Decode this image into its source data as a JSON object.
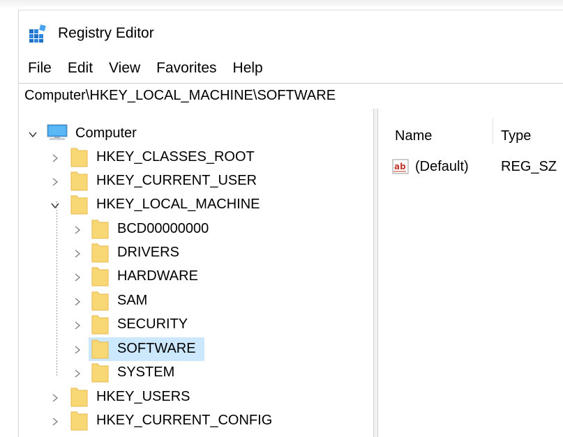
{
  "window": {
    "title": "Registry Editor",
    "app_icon": "registry-editor-icon"
  },
  "menu": [
    "File",
    "Edit",
    "View",
    "Favorites",
    "Help"
  ],
  "address": "Computer\\HKEY_LOCAL_MACHINE\\SOFTWARE",
  "tree": {
    "root": {
      "label": "Computer",
      "icon": "computer-icon",
      "expanded": true
    },
    "hives": [
      {
        "label": "HKEY_CLASSES_ROOT",
        "expanded": false
      },
      {
        "label": "HKEY_CURRENT_USER",
        "expanded": false
      },
      {
        "label": "HKEY_LOCAL_MACHINE",
        "expanded": true
      },
      {
        "label": "HKEY_USERS",
        "expanded": false
      },
      {
        "label": "HKEY_CURRENT_CONFIG",
        "expanded": false
      }
    ],
    "hklm_children": [
      {
        "label": "BCD00000000"
      },
      {
        "label": "DRIVERS"
      },
      {
        "label": "HARDWARE"
      },
      {
        "label": "SAM"
      },
      {
        "label": "SECURITY"
      },
      {
        "label": "SOFTWARE",
        "selected": true
      },
      {
        "label": "SYSTEM"
      }
    ],
    "selected": "SOFTWARE"
  },
  "values_pane": {
    "columns": [
      "Name",
      "Type"
    ],
    "rows": [
      {
        "icon": "string-value-icon",
        "name": "(Default)",
        "type": "REG_SZ"
      }
    ]
  },
  "colors": {
    "selection": "#cce8ff",
    "folder": "#f8d775",
    "folder_dark": "#e8b84a",
    "computer_screen": "#38a1ee"
  }
}
